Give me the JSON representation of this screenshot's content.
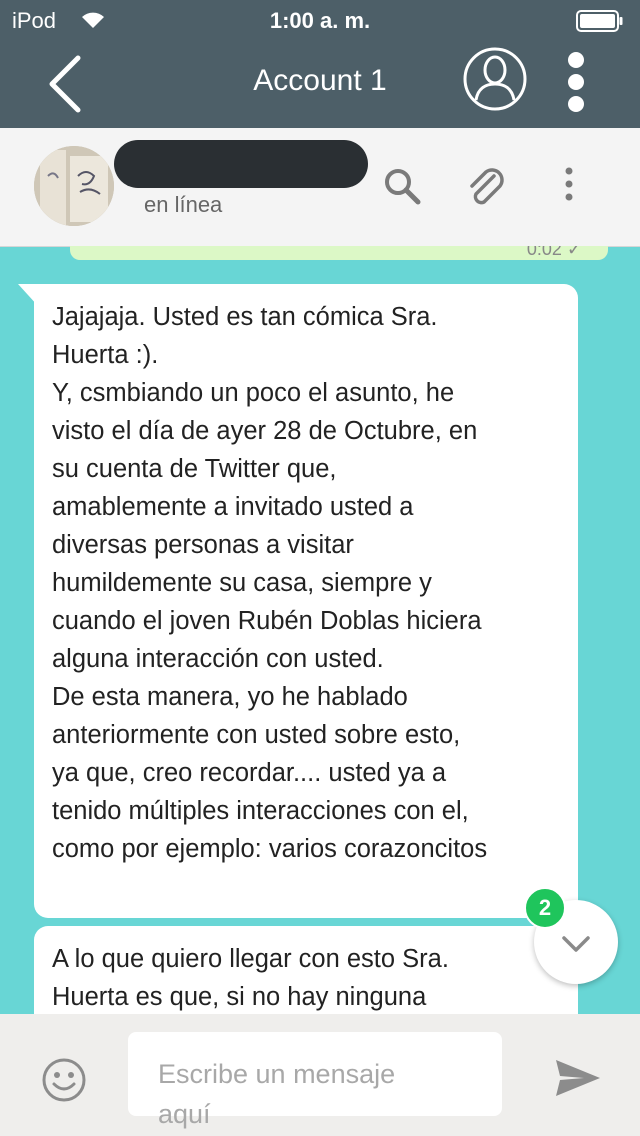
{
  "status_bar": {
    "carrier": "iPod",
    "time": "1:00 a. m."
  },
  "app_bar": {
    "title": "Account 1",
    "icons": [
      "back-icon",
      "account-icon",
      "more-vertical-icon"
    ]
  },
  "chat_header": {
    "status": "en línea",
    "icons": [
      "search-icon",
      "attach-icon",
      "more-vertical-icon"
    ]
  },
  "previous_message": {
    "time": "0:02 ✓"
  },
  "messages": [
    {
      "text": "Jajajaja. Usted es tan cómica Sra.\nHuerta :).\nY, csmbiando un poco el asunto, he\nvisto el día de ayer 28 de Octubre, en\nsu cuenta de Twitter que,\namablemente a invitado usted a\ndiversas personas a visitar\nhumildemente su casa, siempre y\ncuando el joven Rubén Doblas hiciera\nalguna interacción con usted.\nDe esta manera, yo he hablado\nanteriormente con usted sobre esto,\nya que, creo recordar.... usted ya a\ntenido múltiples interacciones con el,\ncomo por ejemplo: varios corazoncitos"
    },
    {
      "text": "A lo que quiero llegar con esto Sra.\nHuerta es  que, si no hay ninguna"
    }
  ],
  "scroll_down": {
    "unread_count": "2"
  },
  "composer": {
    "placeholder": "Escribe un mensaje\naquí",
    "icons": [
      "emoji-icon",
      "send-icon"
    ]
  },
  "colors": {
    "header": "#4d5f68",
    "chat_background": "#68d6d5",
    "badge": "#1fc55c",
    "bubble": "#ffffff"
  }
}
